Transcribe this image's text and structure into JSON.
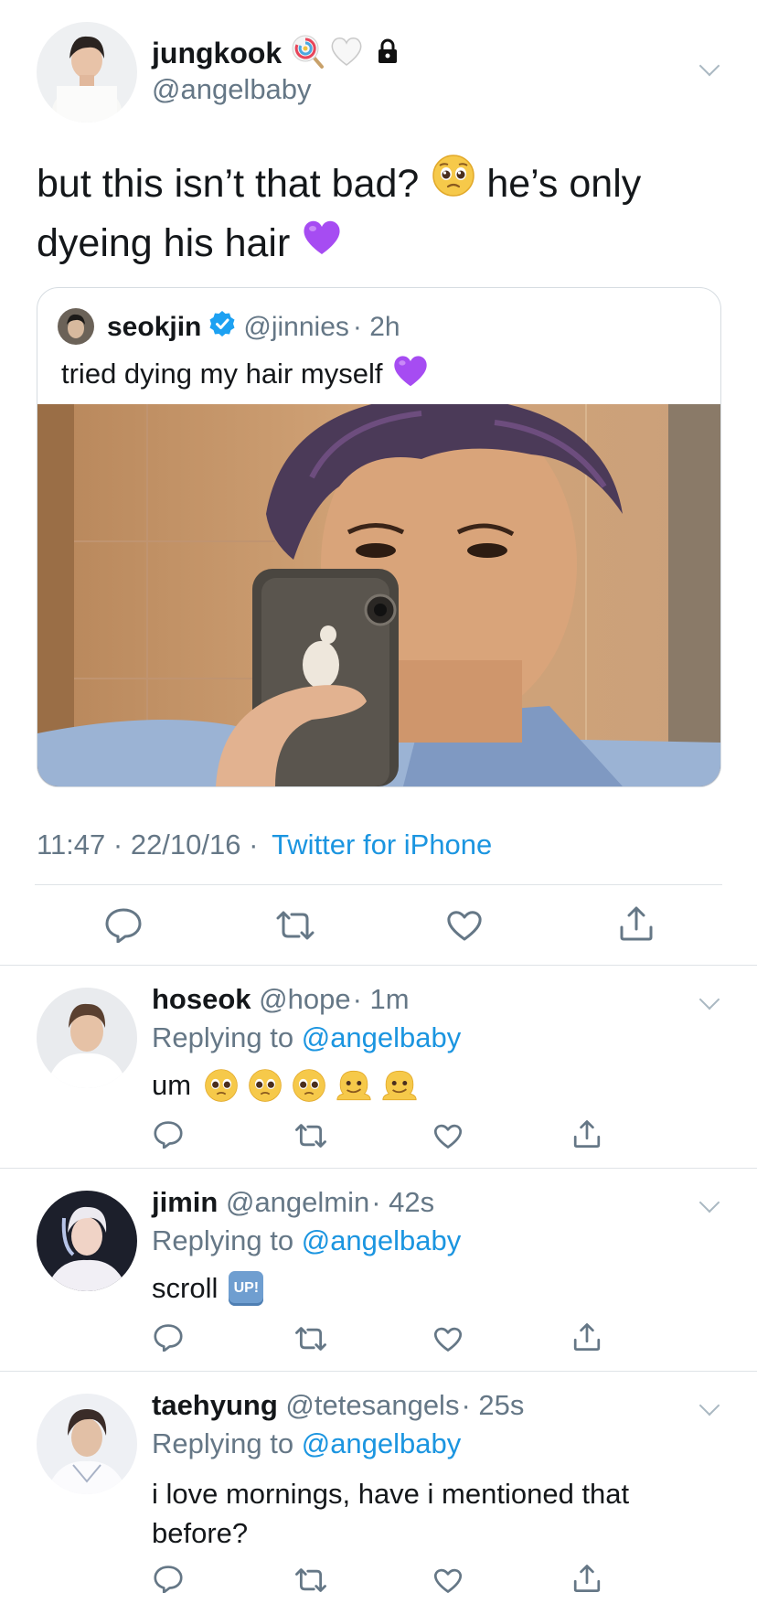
{
  "main_tweet": {
    "name": "jungkook",
    "name_emojis": [
      "lollipop-emoji",
      "white-heart-emoji",
      "lock-icon"
    ],
    "handle": "@angelbaby",
    "text_line1": "but this isn’t that bad?",
    "text_line1b": "he’s only",
    "text_line2": "dyeing his hair",
    "timestamp": "11:47 · 22/10/16 ·",
    "source": "Twitter for iPhone",
    "quoted": {
      "name": "seokjin",
      "handle": "@jinnies",
      "time": "· 2h",
      "text": "tried dying my hair myself"
    }
  },
  "replies": [
    {
      "name": "hoseok",
      "handle": "@hope",
      "time": "· 1m",
      "replying_prefix": "Replying to",
      "replying_to": "@angelbaby",
      "text": "um"
    },
    {
      "name": "jimin",
      "handle": "@angelmin",
      "time": "· 42s",
      "replying_prefix": "Replying to",
      "replying_to": "@angelbaby",
      "text": "scroll",
      "badge": "UP!"
    },
    {
      "name": "taehyung",
      "handle": "@tetesangels",
      "time": "· 25s",
      "replying_prefix": "Replying to",
      "replying_to": "@angelbaby",
      "text_line1": "i love mornings, have i mentioned that",
      "text_line2": "before?"
    }
  ],
  "colors": {
    "link": "#1b95e0",
    "muted": "#657786",
    "verified": "#1da1f2",
    "purple_heart": "#a64cf2"
  }
}
